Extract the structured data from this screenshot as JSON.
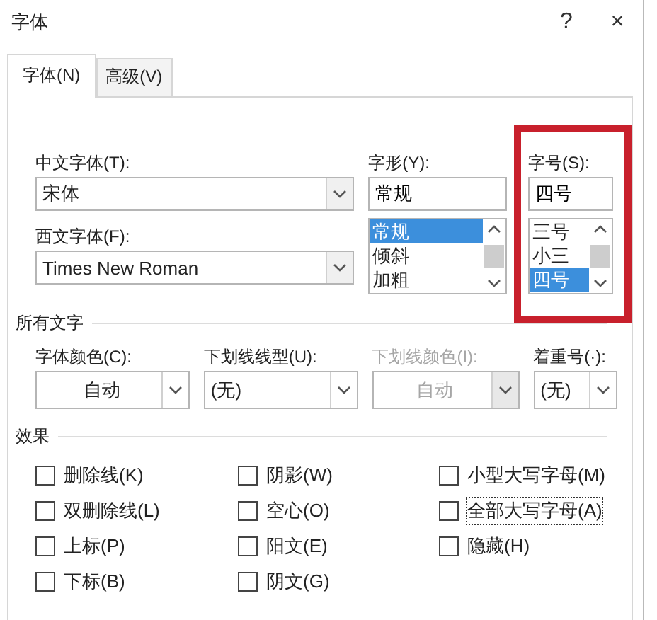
{
  "window": {
    "title": "字体",
    "help": "?",
    "close": "×"
  },
  "tabs": [
    {
      "label": "字体(N)",
      "selected": true
    },
    {
      "label": "高级(V)",
      "selected": false
    }
  ],
  "font": {
    "chinese_font": {
      "label": "中文字体(T):",
      "value": "宋体"
    },
    "western_font": {
      "label": "西文字体(F):",
      "value": "Times New Roman"
    },
    "style": {
      "label": "字形(Y):",
      "value": "常规",
      "options": [
        {
          "label": "常规",
          "selected": true
        },
        {
          "label": "倾斜",
          "selected": false
        },
        {
          "label": "加粗",
          "selected": false
        }
      ]
    },
    "size": {
      "label": "字号(S):",
      "value": "四号",
      "highlighted": true,
      "options": [
        {
          "label": "三号",
          "selected": false
        },
        {
          "label": "小三",
          "selected": false
        },
        {
          "label": "四号",
          "selected": true
        }
      ]
    }
  },
  "all_text": {
    "title": "所有文字",
    "fields": [
      {
        "label": "字体颜色(C):",
        "value": "自动",
        "kind": "centered",
        "disabled": false
      },
      {
        "label": "下划线线型(U):",
        "value": "(无)",
        "kind": "left",
        "disabled": false
      },
      {
        "label": "下划线颜色(I):",
        "value": "自动",
        "kind": "centered",
        "disabled": true
      },
      {
        "label": "着重号(·):",
        "value": "(无)",
        "kind": "left",
        "disabled": false
      }
    ]
  },
  "effects": {
    "title": "效果",
    "checkboxes": [
      {
        "label": "删除线(K)",
        "checked": false,
        "focused": false
      },
      {
        "label": "阴影(W)",
        "checked": false,
        "focused": false
      },
      {
        "label": "小型大写字母(M)",
        "checked": false,
        "focused": false
      },
      {
        "label": "双删除线(L)",
        "checked": false,
        "focused": false
      },
      {
        "label": "空心(O)",
        "checked": false,
        "focused": false
      },
      {
        "label": "全部大写字母(A)",
        "checked": false,
        "focused": true
      },
      {
        "label": "上标(P)",
        "checked": false,
        "focused": false
      },
      {
        "label": "阳文(E)",
        "checked": false,
        "focused": false
      },
      {
        "label": "隐藏(H)",
        "checked": false,
        "focused": false
      },
      {
        "label": "下标(B)",
        "checked": false,
        "focused": false
      },
      {
        "label": "阴文(G)",
        "checked": false,
        "focused": false
      }
    ]
  }
}
